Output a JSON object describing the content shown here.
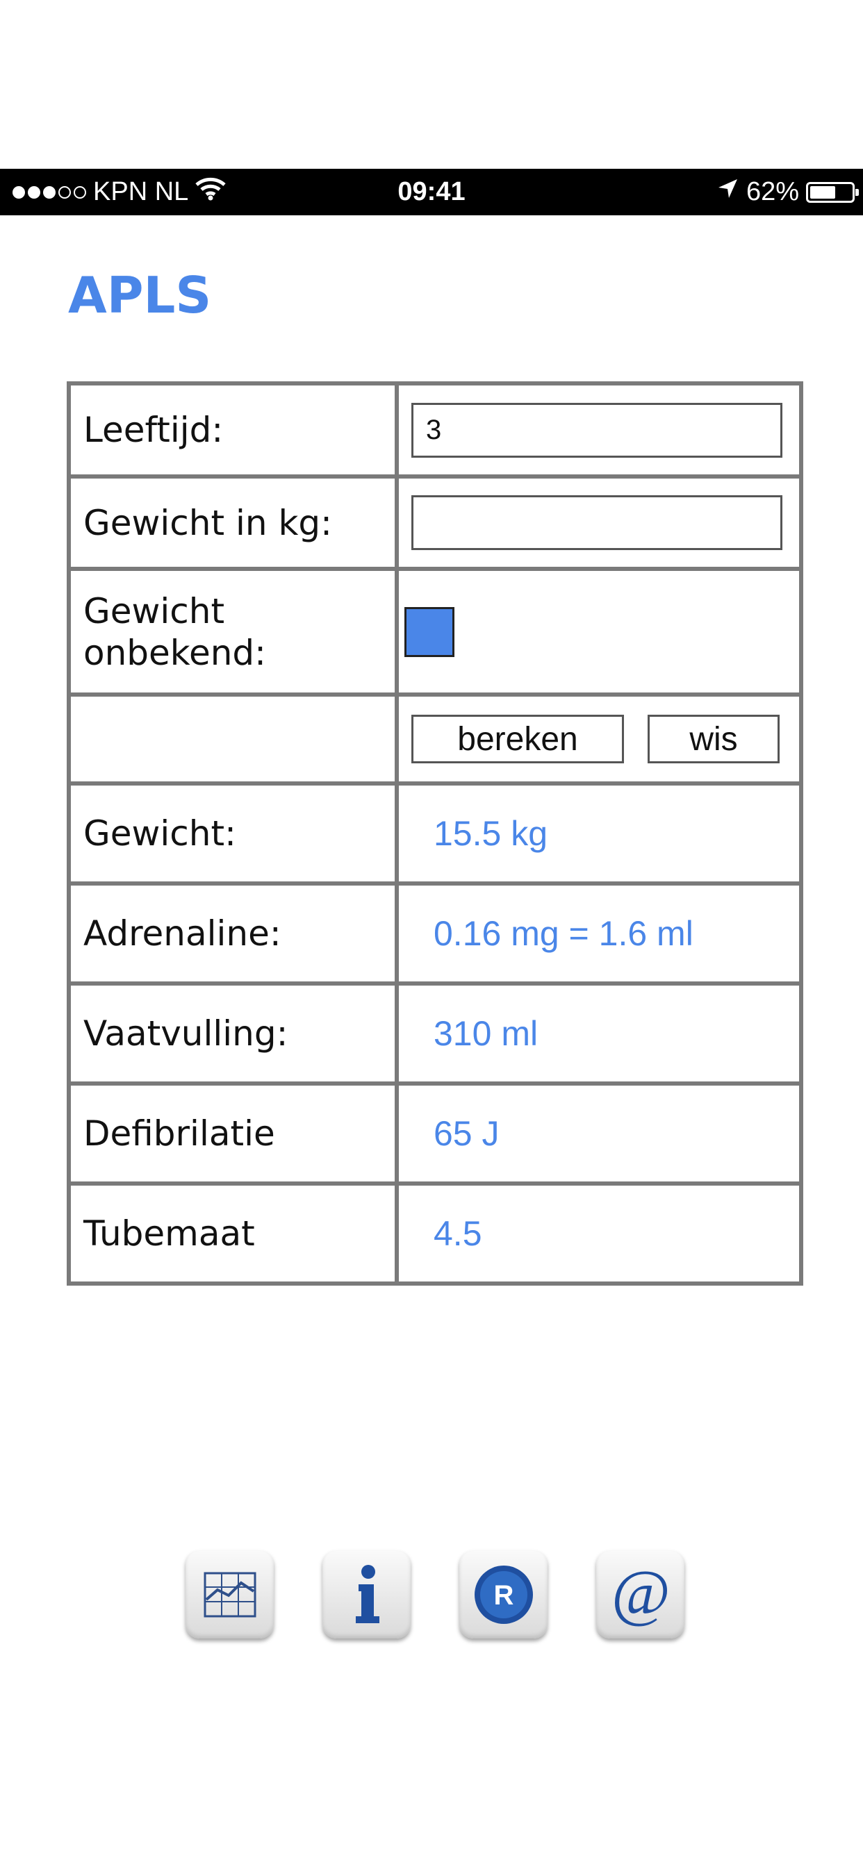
{
  "status_bar": {
    "signal_dots_on": 3,
    "signal_dots_off": 2,
    "carrier": "KPN NL",
    "time": "09:41",
    "battery": "62%",
    "battery_level": 0.62,
    "icons": [
      "wifi-icon",
      "location-arrow-icon",
      "battery-icon"
    ]
  },
  "page": {
    "title": "APLS",
    "accent_color": "#4a86e8"
  },
  "form": {
    "age_label": "Leeftijd:",
    "age_value": "3",
    "weight_label": "Gewicht in kg:",
    "weight_value": "",
    "weight_unknown_label_line1": "Gewicht",
    "weight_unknown_label_line2": "onbekend:",
    "weight_unknown_checked": true,
    "calculate_label": "bereken",
    "clear_label": "wis"
  },
  "results": [
    {
      "label": "Gewicht:",
      "value": "15.5 kg"
    },
    {
      "label": "Adrenaline:",
      "value": "0.16 mg = 1.6 ml"
    },
    {
      "label": "Vaatvulling:",
      "value": "310 ml"
    },
    {
      "label": "Defibrilatie",
      "value": "65 J"
    },
    {
      "label": "Tubemaat",
      "value": "4.5"
    }
  ],
  "dock": {
    "items": [
      "chart-icon",
      "info-icon",
      "registered-icon",
      "email-at-icon"
    ]
  }
}
